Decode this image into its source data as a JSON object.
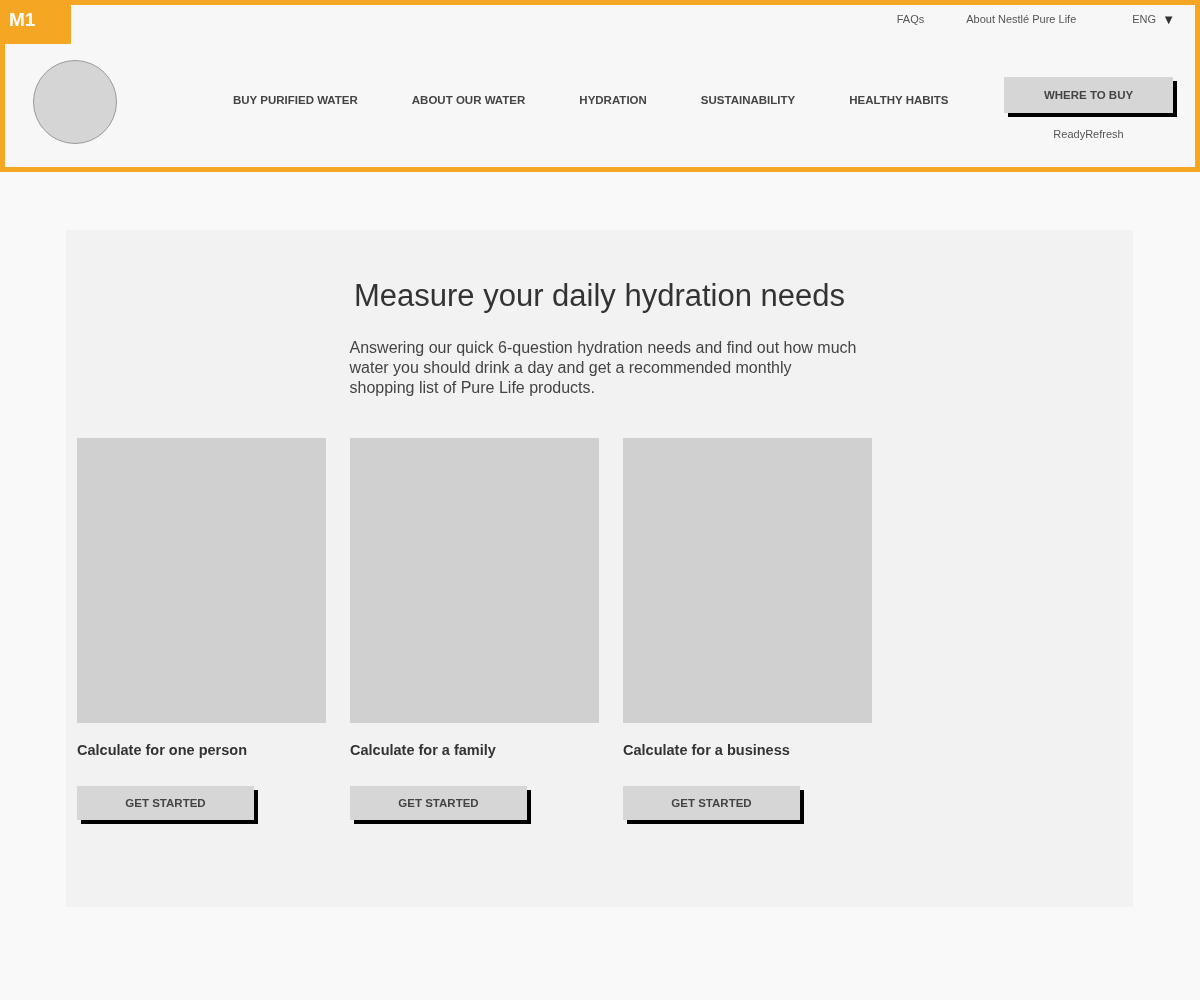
{
  "badge": "M1",
  "utility_links": [
    "FAQs",
    "About Nestlé Pure Life"
  ],
  "language": {
    "label": "ENG",
    "caret": "▼"
  },
  "nav": [
    "BUY PURIFIED WATER",
    "ABOUT OUR WATER",
    "HYDRATION",
    "SUSTAINABILITY",
    "HEALTHY HABITS"
  ],
  "cta": {
    "label": "WHERE TO BUY",
    "sublink": "ReadyRefresh"
  },
  "hero": {
    "title": "Measure your daily hydration needs",
    "text": "Answering our quick 6-question hydration needs and find out how much water you should drink a day and get a recommended monthly shopping list of Pure Life products."
  },
  "cards": [
    {
      "title": "Calculate for one person",
      "button": "GET STARTED"
    },
    {
      "title": "Calculate for a family",
      "button": "GET STARTED"
    },
    {
      "title": "Calculate for a business",
      "button": "GET STARTED"
    }
  ]
}
